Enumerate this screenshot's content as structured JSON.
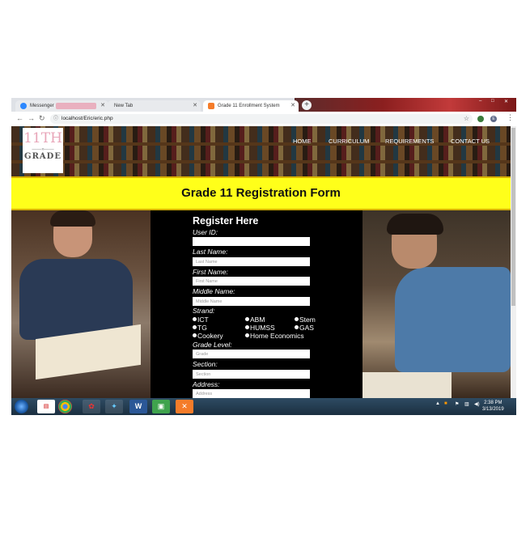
{
  "browser": {
    "tabs": [
      {
        "label": "Messenger",
        "icon": "messenger-icon"
      },
      {
        "label": "New Tab",
        "icon": "none"
      },
      {
        "label": "Grade 11 Enrollment System",
        "icon": "xampp-icon"
      }
    ],
    "new_tab_glyph": "+",
    "url": "localhost/Eric/eric.php",
    "profile_initial": "E",
    "window_controls": [
      "–",
      "□",
      "✕"
    ]
  },
  "site": {
    "logo": {
      "top": "11TH",
      "bottom": "GRADE",
      "arrow": "——»——"
    },
    "menu": [
      "HOME",
      "CURRICULUM",
      "REQUIREMENTS",
      "CONTACT US"
    ],
    "form_title": "Grade 11 Registration Form"
  },
  "form": {
    "heading": "Register Here",
    "user_id_label": "User ID:",
    "last_name_label": "Last Name:",
    "last_name_placeholder": "Last Name",
    "first_name_label": "First Name:",
    "first_name_placeholder": "First Name",
    "middle_name_label": "Middle Name:",
    "middle_name_placeholder": "Middle Name",
    "strand_label": "Strand:",
    "strands": [
      "ICT",
      "ABM",
      "Stem",
      "TG",
      "HUMSS",
      "GAS",
      "Cookery",
      "Home Economics"
    ],
    "grade_level_label": "Grade Level:",
    "grade_placeholder": "Grade",
    "section_label": "Section:",
    "section_placeholder": "Section",
    "address_label": "Address:",
    "address_placeholder": "Address"
  },
  "taskbar": {
    "apps": [
      "pdf-icon",
      "chrome-icon",
      "sticky-icon",
      "network-icon",
      "word-icon",
      "photos-icon",
      "xampp-icon"
    ],
    "time": "2:38 PM",
    "date": "3/13/2019"
  },
  "colors": {
    "title_bar": "#ffff1a",
    "form_bg": "#000000",
    "taskbar": "#1b2f40"
  }
}
